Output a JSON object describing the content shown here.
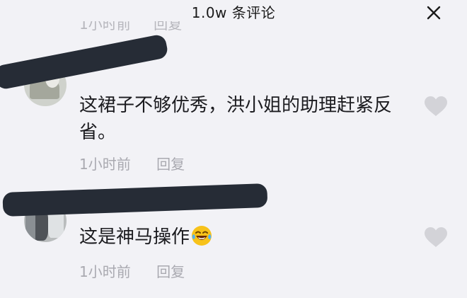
{
  "header": {
    "title": "1.0w 条评论",
    "close_icon": "close-icon"
  },
  "partial_prev": {
    "time": "1小时前",
    "reply": "回复"
  },
  "comments": [
    {
      "username": "",
      "text": "这裙子不够优秀，洪小姐的助理赶紧反省。",
      "time": "1小时前",
      "reply": "回复",
      "like_icon": "heart-icon"
    },
    {
      "username": "",
      "text": "这是神马操作",
      "emoji": "laughing-crying-emoji",
      "time": "1小时前",
      "reply": "回复",
      "like_icon": "heart-icon"
    }
  ],
  "colors": {
    "background": "#f2f2f6",
    "text": "#1b1b1f",
    "meta": "#a9a9b0",
    "redaction": "#262c36"
  }
}
